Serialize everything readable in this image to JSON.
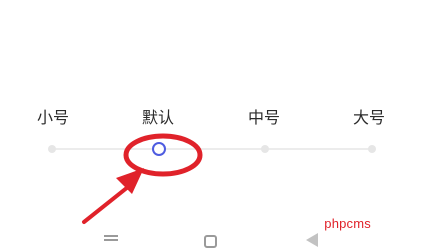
{
  "font_size_setting": {
    "options": [
      {
        "label": "小号"
      },
      {
        "label": "默认"
      },
      {
        "label": "中号"
      },
      {
        "label": "大号"
      }
    ],
    "selected_index": 1,
    "selected_label": "默认"
  },
  "accent_color": "#4e5ce0",
  "annotation_color": "#e0222a",
  "navigation_bar": {
    "icons": [
      "menu-icon",
      "home-icon",
      "back-icon"
    ]
  },
  "watermark": {
    "text": "phpcms"
  }
}
